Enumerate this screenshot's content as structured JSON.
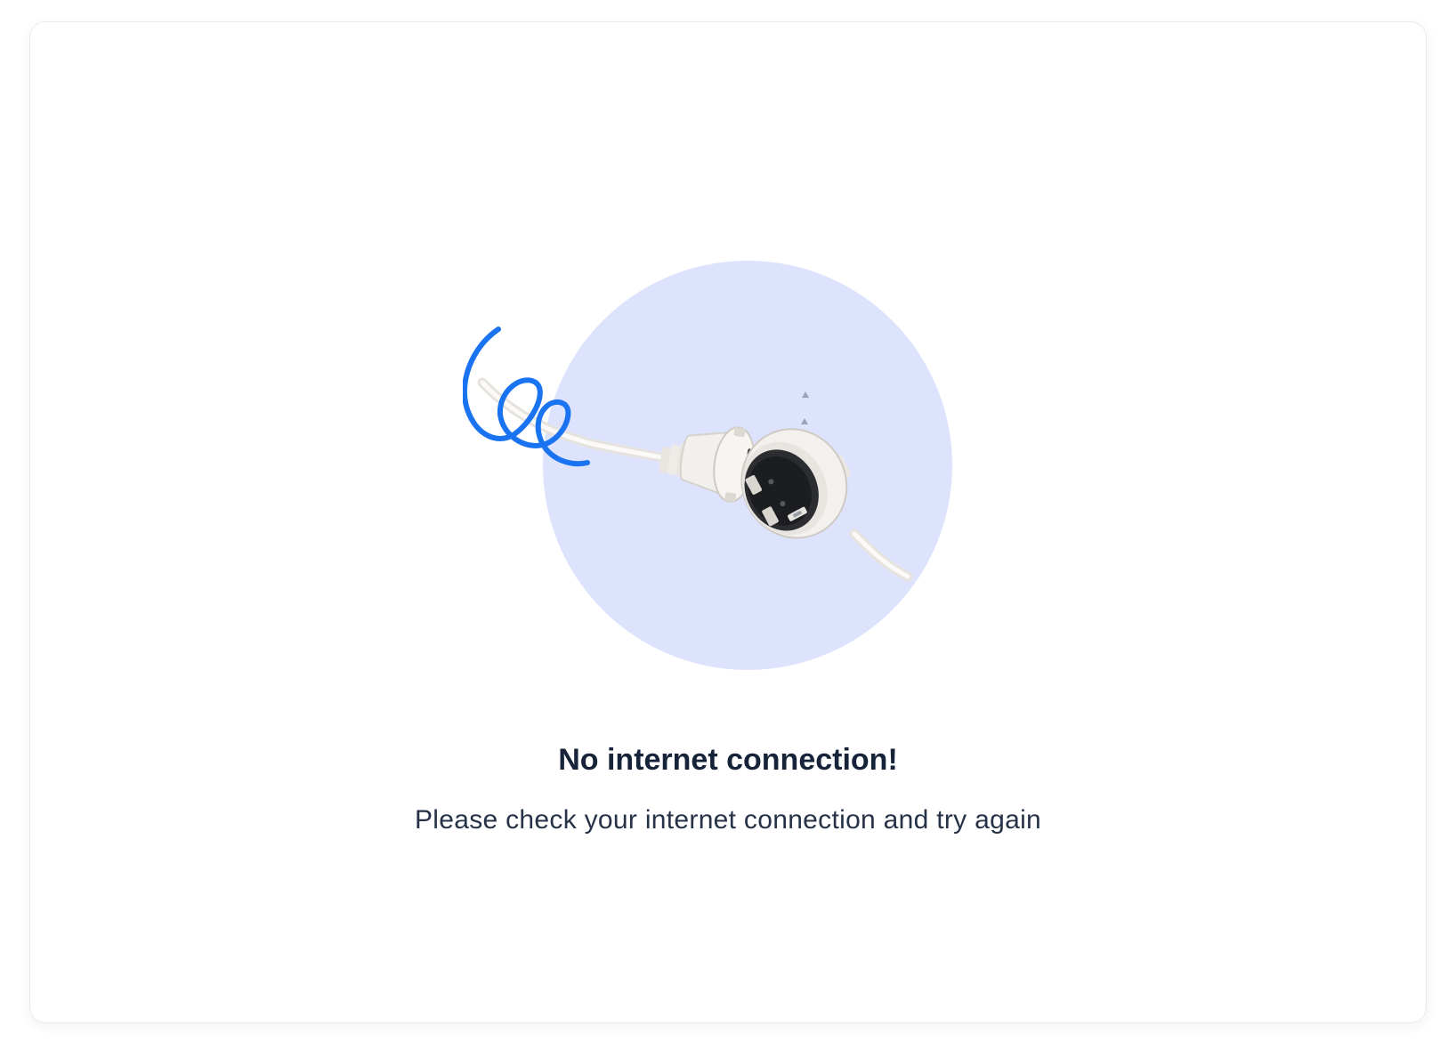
{
  "empty_state": {
    "title": "No internet connection!",
    "message": "Please check your internet connection and try again",
    "illustration": {
      "icon": "unplugged-cable-icon",
      "circle_color": "#dde3fd",
      "squiggle_color": "#1a73f0",
      "cable_color": "#f1efec"
    }
  }
}
